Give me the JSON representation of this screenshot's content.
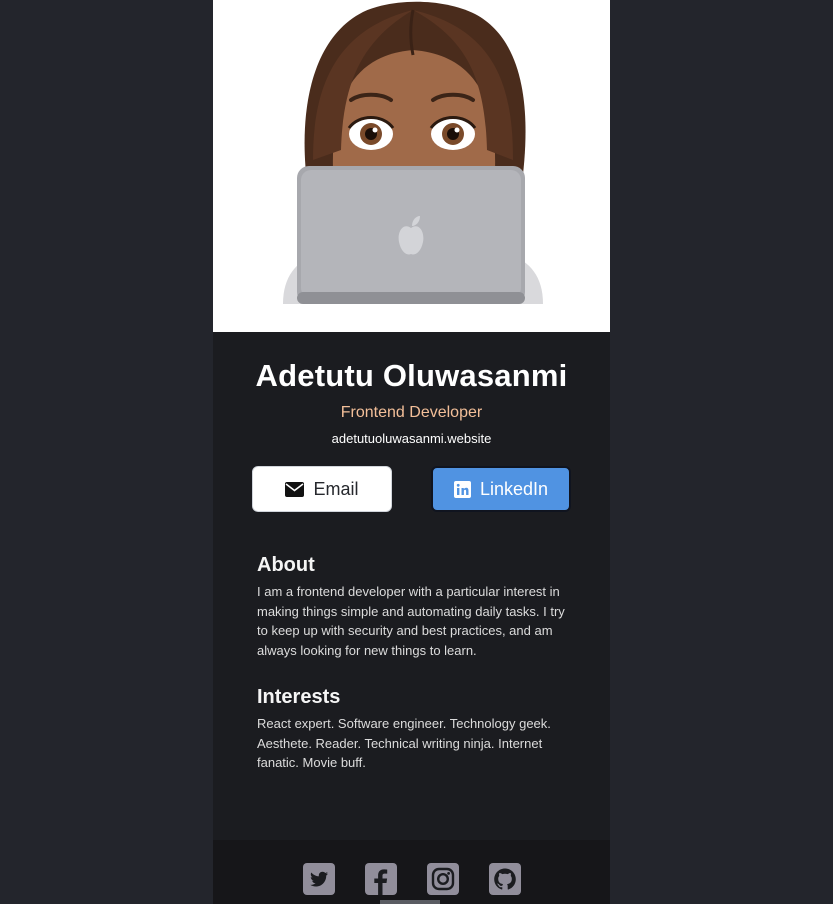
{
  "profile": {
    "name": "Adetutu Oluwasanmi",
    "role": "Frontend Developer",
    "website": "adetutuoluwasanmi.website"
  },
  "buttons": {
    "email": {
      "label": "Email",
      "icon": "envelope-icon"
    },
    "linkedin": {
      "label": "LinkedIn",
      "icon": "linkedin-icon"
    }
  },
  "about": {
    "heading": "About",
    "body": "I am a frontend developer with a particular interest in making things simple and automating daily tasks. I try to keep up with security and best practices, and am always looking for new things to learn."
  },
  "interests": {
    "heading": "Interests",
    "body": "React expert. Software engineer. Technology geek. Aesthete. Reader. Technical writing ninja. Internet fanatic. Movie buff."
  },
  "footer": {
    "social_icons": [
      "twitter-icon",
      "facebook-icon",
      "instagram-icon",
      "github-icon"
    ]
  },
  "colors": {
    "page_background": "#23252c",
    "card_background": "#1b1c20",
    "footer_background": "#161619",
    "role_accent": "#f3bf99",
    "linkedin_button": "#5093e2",
    "email_button": "#ffffff",
    "social_icon": "#918e9b"
  }
}
